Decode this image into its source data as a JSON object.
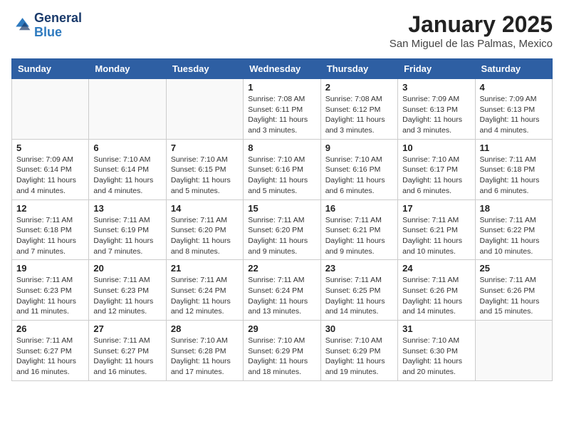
{
  "header": {
    "logo_general": "General",
    "logo_blue": "Blue",
    "month_title": "January 2025",
    "subtitle": "San Miguel de las Palmas, Mexico"
  },
  "weekdays": [
    "Sunday",
    "Monday",
    "Tuesday",
    "Wednesday",
    "Thursday",
    "Friday",
    "Saturday"
  ],
  "weeks": [
    [
      {
        "day": "",
        "sunrise": "",
        "sunset": "",
        "daylight": ""
      },
      {
        "day": "",
        "sunrise": "",
        "sunset": "",
        "daylight": ""
      },
      {
        "day": "",
        "sunrise": "",
        "sunset": "",
        "daylight": ""
      },
      {
        "day": "1",
        "sunrise": "Sunrise: 7:08 AM",
        "sunset": "Sunset: 6:11 PM",
        "daylight": "Daylight: 11 hours and 3 minutes."
      },
      {
        "day": "2",
        "sunrise": "Sunrise: 7:08 AM",
        "sunset": "Sunset: 6:12 PM",
        "daylight": "Daylight: 11 hours and 3 minutes."
      },
      {
        "day": "3",
        "sunrise": "Sunrise: 7:09 AM",
        "sunset": "Sunset: 6:13 PM",
        "daylight": "Daylight: 11 hours and 3 minutes."
      },
      {
        "day": "4",
        "sunrise": "Sunrise: 7:09 AM",
        "sunset": "Sunset: 6:13 PM",
        "daylight": "Daylight: 11 hours and 4 minutes."
      }
    ],
    [
      {
        "day": "5",
        "sunrise": "Sunrise: 7:09 AM",
        "sunset": "Sunset: 6:14 PM",
        "daylight": "Daylight: 11 hours and 4 minutes."
      },
      {
        "day": "6",
        "sunrise": "Sunrise: 7:10 AM",
        "sunset": "Sunset: 6:14 PM",
        "daylight": "Daylight: 11 hours and 4 minutes."
      },
      {
        "day": "7",
        "sunrise": "Sunrise: 7:10 AM",
        "sunset": "Sunset: 6:15 PM",
        "daylight": "Daylight: 11 hours and 5 minutes."
      },
      {
        "day": "8",
        "sunrise": "Sunrise: 7:10 AM",
        "sunset": "Sunset: 6:16 PM",
        "daylight": "Daylight: 11 hours and 5 minutes."
      },
      {
        "day": "9",
        "sunrise": "Sunrise: 7:10 AM",
        "sunset": "Sunset: 6:16 PM",
        "daylight": "Daylight: 11 hours and 6 minutes."
      },
      {
        "day": "10",
        "sunrise": "Sunrise: 7:10 AM",
        "sunset": "Sunset: 6:17 PM",
        "daylight": "Daylight: 11 hours and 6 minutes."
      },
      {
        "day": "11",
        "sunrise": "Sunrise: 7:11 AM",
        "sunset": "Sunset: 6:18 PM",
        "daylight": "Daylight: 11 hours and 6 minutes."
      }
    ],
    [
      {
        "day": "12",
        "sunrise": "Sunrise: 7:11 AM",
        "sunset": "Sunset: 6:18 PM",
        "daylight": "Daylight: 11 hours and 7 minutes."
      },
      {
        "day": "13",
        "sunrise": "Sunrise: 7:11 AM",
        "sunset": "Sunset: 6:19 PM",
        "daylight": "Daylight: 11 hours and 7 minutes."
      },
      {
        "day": "14",
        "sunrise": "Sunrise: 7:11 AM",
        "sunset": "Sunset: 6:20 PM",
        "daylight": "Daylight: 11 hours and 8 minutes."
      },
      {
        "day": "15",
        "sunrise": "Sunrise: 7:11 AM",
        "sunset": "Sunset: 6:20 PM",
        "daylight": "Daylight: 11 hours and 9 minutes."
      },
      {
        "day": "16",
        "sunrise": "Sunrise: 7:11 AM",
        "sunset": "Sunset: 6:21 PM",
        "daylight": "Daylight: 11 hours and 9 minutes."
      },
      {
        "day": "17",
        "sunrise": "Sunrise: 7:11 AM",
        "sunset": "Sunset: 6:21 PM",
        "daylight": "Daylight: 11 hours and 10 minutes."
      },
      {
        "day": "18",
        "sunrise": "Sunrise: 7:11 AM",
        "sunset": "Sunset: 6:22 PM",
        "daylight": "Daylight: 11 hours and 10 minutes."
      }
    ],
    [
      {
        "day": "19",
        "sunrise": "Sunrise: 7:11 AM",
        "sunset": "Sunset: 6:23 PM",
        "daylight": "Daylight: 11 hours and 11 minutes."
      },
      {
        "day": "20",
        "sunrise": "Sunrise: 7:11 AM",
        "sunset": "Sunset: 6:23 PM",
        "daylight": "Daylight: 11 hours and 12 minutes."
      },
      {
        "day": "21",
        "sunrise": "Sunrise: 7:11 AM",
        "sunset": "Sunset: 6:24 PM",
        "daylight": "Daylight: 11 hours and 12 minutes."
      },
      {
        "day": "22",
        "sunrise": "Sunrise: 7:11 AM",
        "sunset": "Sunset: 6:24 PM",
        "daylight": "Daylight: 11 hours and 13 minutes."
      },
      {
        "day": "23",
        "sunrise": "Sunrise: 7:11 AM",
        "sunset": "Sunset: 6:25 PM",
        "daylight": "Daylight: 11 hours and 14 minutes."
      },
      {
        "day": "24",
        "sunrise": "Sunrise: 7:11 AM",
        "sunset": "Sunset: 6:26 PM",
        "daylight": "Daylight: 11 hours and 14 minutes."
      },
      {
        "day": "25",
        "sunrise": "Sunrise: 7:11 AM",
        "sunset": "Sunset: 6:26 PM",
        "daylight": "Daylight: 11 hours and 15 minutes."
      }
    ],
    [
      {
        "day": "26",
        "sunrise": "Sunrise: 7:11 AM",
        "sunset": "Sunset: 6:27 PM",
        "daylight": "Daylight: 11 hours and 16 minutes."
      },
      {
        "day": "27",
        "sunrise": "Sunrise: 7:11 AM",
        "sunset": "Sunset: 6:27 PM",
        "daylight": "Daylight: 11 hours and 16 minutes."
      },
      {
        "day": "28",
        "sunrise": "Sunrise: 7:10 AM",
        "sunset": "Sunset: 6:28 PM",
        "daylight": "Daylight: 11 hours and 17 minutes."
      },
      {
        "day": "29",
        "sunrise": "Sunrise: 7:10 AM",
        "sunset": "Sunset: 6:29 PM",
        "daylight": "Daylight: 11 hours and 18 minutes."
      },
      {
        "day": "30",
        "sunrise": "Sunrise: 7:10 AM",
        "sunset": "Sunset: 6:29 PM",
        "daylight": "Daylight: 11 hours and 19 minutes."
      },
      {
        "day": "31",
        "sunrise": "Sunrise: 7:10 AM",
        "sunset": "Sunset: 6:30 PM",
        "daylight": "Daylight: 11 hours and 20 minutes."
      },
      {
        "day": "",
        "sunrise": "",
        "sunset": "",
        "daylight": ""
      }
    ]
  ]
}
